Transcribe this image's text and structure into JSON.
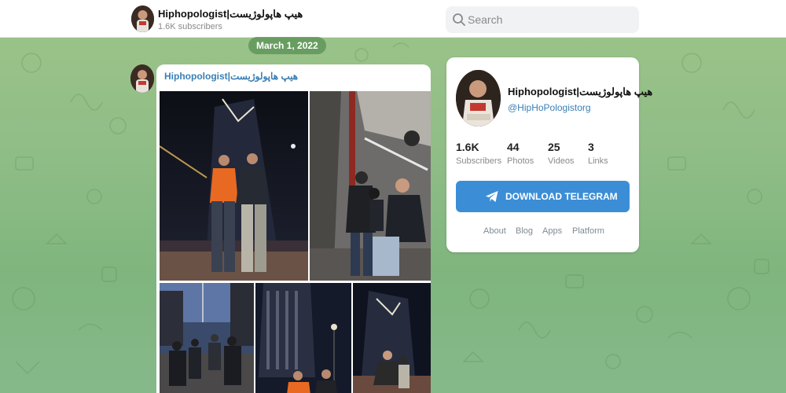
{
  "header": {
    "channel_title": "Hiphopologist|هیپ هاپولوژیست",
    "subscribers": "1.6K subscribers",
    "search_placeholder": "Search"
  },
  "feed": {
    "date_label": "March 1, 2022",
    "post": {
      "author": "Hiphopologist|هیپ هاپولوژیست"
    }
  },
  "channel_card": {
    "title": "Hiphopologist|هیپ هاپولوژیست",
    "handle": "@HipHoPologistorg",
    "stats": [
      {
        "value": "1.6K",
        "label": "Subscribers"
      },
      {
        "value": "44",
        "label": "Photos"
      },
      {
        "value": "25",
        "label": "Videos"
      },
      {
        "value": "3",
        "label": "Links"
      }
    ],
    "download_button": "DOWNLOAD TELEGRAM",
    "footer_links": [
      "About",
      "Blog",
      "Apps",
      "Platform"
    ]
  },
  "colors": {
    "accent": "#3b8ed6",
    "link": "#3a7fb5",
    "background_green": "#8fbd86"
  },
  "icons": {
    "search": "search-icon",
    "download": "telegram-plane-icon"
  }
}
